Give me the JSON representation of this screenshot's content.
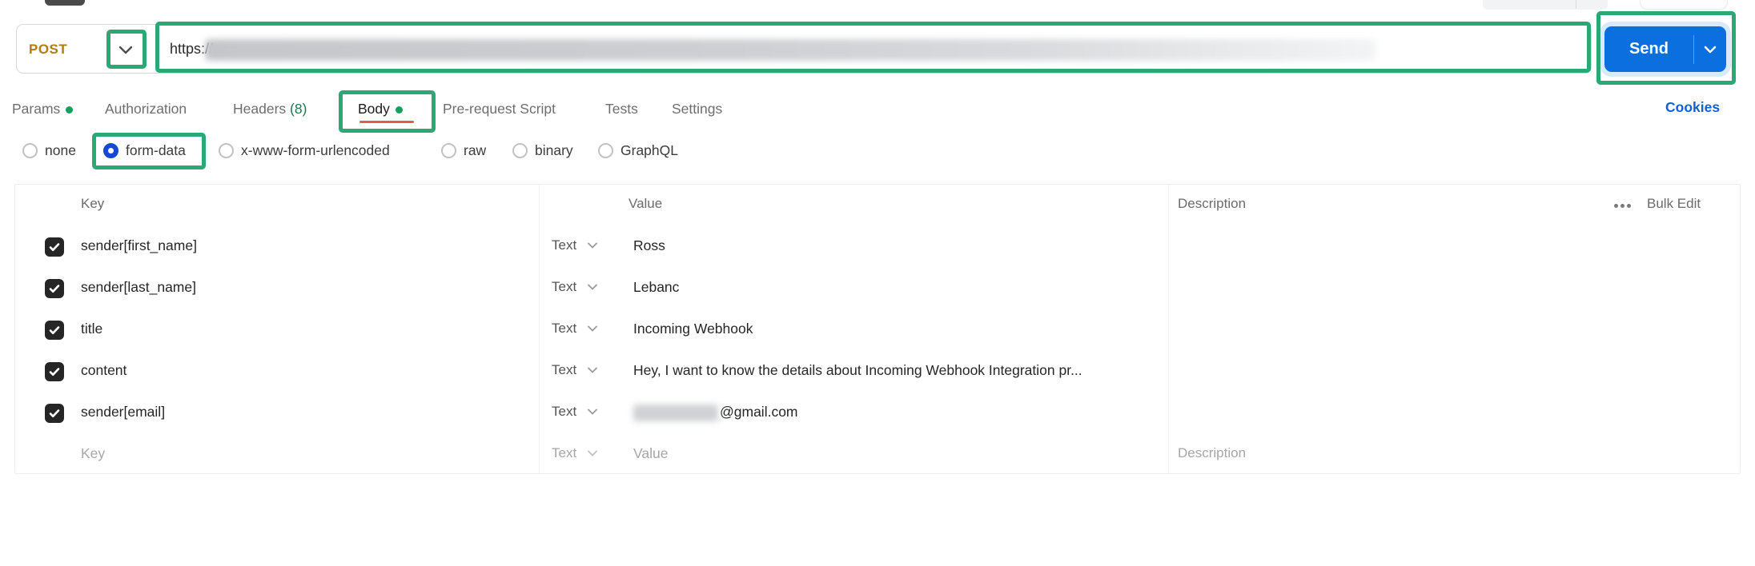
{
  "colors": {
    "annotation_green": "#2aa876",
    "send_blue": "#0b6fe0",
    "post_amber": "#b07c0e",
    "cookies_blue": "#0f62d6",
    "tab_indicator_orange": "#e05f3c",
    "dot_green": "#13a05b",
    "headers_count_green": "#187a4b"
  },
  "request_bar": {
    "method": "POST",
    "url_prefix": "https://",
    "send_label": "Send"
  },
  "tabs": {
    "params_label": "Params",
    "authorization_label": "Authorization",
    "headers_label": "Headers",
    "headers_count": "(8)",
    "body_label": "Body",
    "prerequest_label": "Pre-request Script",
    "tests_label": "Tests",
    "settings_label": "Settings",
    "cookies_label": "Cookies"
  },
  "body_type": {
    "selected": "form-data",
    "options": [
      {
        "label": "none",
        "checked": false
      },
      {
        "label": "form-data",
        "checked": true
      },
      {
        "label": "x-www-form-urlencoded",
        "checked": false
      },
      {
        "label": "raw",
        "checked": false
      },
      {
        "label": "binary",
        "checked": false
      },
      {
        "label": "GraphQL",
        "checked": false
      }
    ]
  },
  "table": {
    "headers": {
      "key": "Key",
      "value": "Value",
      "description": "Description",
      "bulk_edit": "Bulk Edit"
    },
    "rows": [
      {
        "key": "sender[first_name]",
        "type": "Text",
        "value": "Ross",
        "checked": true
      },
      {
        "key": "sender[last_name]",
        "type": "Text",
        "value": "Lebanc",
        "checked": true
      },
      {
        "key": "title",
        "type": "Text",
        "value": "Incoming Webhook",
        "checked": true
      },
      {
        "key": "content",
        "type": "Text",
        "value": "Hey, I want to know the details about Incoming Webhook Integration pr...",
        "checked": true
      },
      {
        "key": "sender[email]",
        "type": "Text",
        "value": "@gmail.com",
        "value_redacted_prefix": true,
        "checked": true
      }
    ],
    "empty_row": {
      "key_placeholder": "Key",
      "type": "Text",
      "value_placeholder": "Value",
      "description_placeholder": "Description"
    }
  }
}
